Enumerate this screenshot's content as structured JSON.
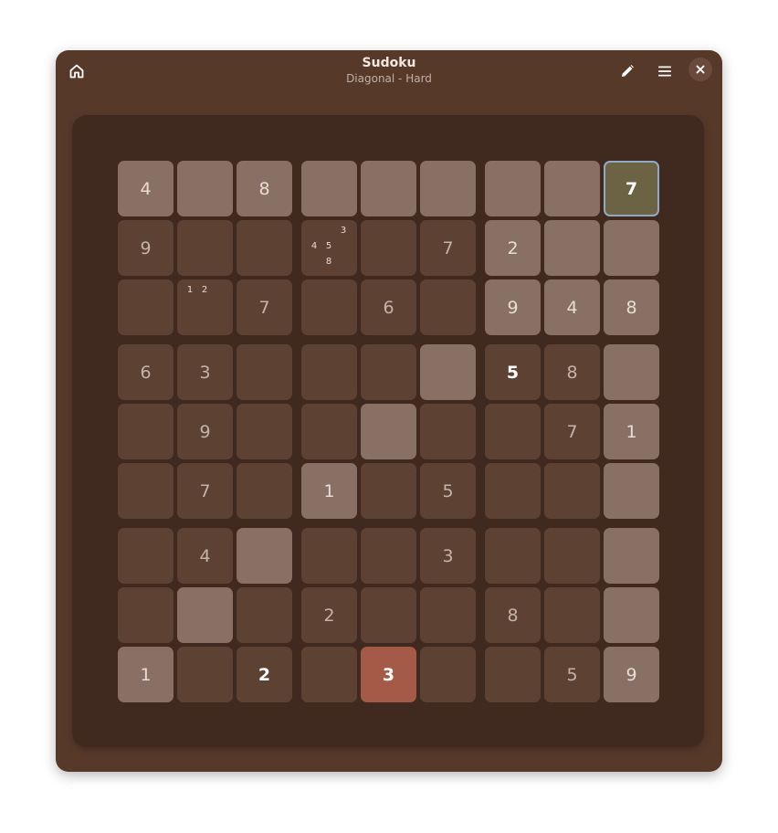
{
  "header": {
    "title": "Sudoku",
    "subtitle": "Diagonal - Hard",
    "buttons": {
      "home": "home-icon",
      "pencil": "pencil-icon",
      "menu": "hamburger-menu-icon",
      "close": "close-icon"
    }
  },
  "colors": {
    "window_bg": "#57392a",
    "board_bg": "#40291f",
    "cell_dark": "#5d4234",
    "cell_light": "#887064",
    "cell_selected": "#6b6343",
    "cell_selected_border": "#8fa9c6",
    "cell_error": "#a55a48"
  },
  "board": {
    "selected_cell": [
      0,
      8
    ],
    "error_cell": [
      8,
      4
    ],
    "cells": [
      [
        {
          "v": "4",
          "shade": "light"
        },
        {
          "v": "",
          "shade": "light"
        },
        {
          "v": "8",
          "shade": "light"
        },
        {
          "v": "",
          "shade": "light"
        },
        {
          "v": "",
          "shade": "light"
        },
        {
          "v": "",
          "shade": "light"
        },
        {
          "v": "",
          "shade": "light"
        },
        {
          "v": "",
          "shade": "light"
        },
        {
          "v": "7",
          "shade": "selected"
        }
      ],
      [
        {
          "v": "9",
          "shade": "dark"
        },
        {
          "v": "",
          "shade": "dark"
        },
        {
          "v": "",
          "shade": "dark"
        },
        {
          "v": "",
          "shade": "dark",
          "notes": [
            "3",
            "4",
            "5",
            "8"
          ]
        },
        {
          "v": "",
          "shade": "dark"
        },
        {
          "v": "7",
          "shade": "dark"
        },
        {
          "v": "2",
          "shade": "light"
        },
        {
          "v": "",
          "shade": "light"
        },
        {
          "v": "",
          "shade": "light"
        }
      ],
      [
        {
          "v": "",
          "shade": "dark"
        },
        {
          "v": "",
          "shade": "dark",
          "notes": [
            "1",
            "2"
          ]
        },
        {
          "v": "7",
          "shade": "dark"
        },
        {
          "v": "",
          "shade": "dark"
        },
        {
          "v": "6",
          "shade": "dark"
        },
        {
          "v": "",
          "shade": "dark"
        },
        {
          "v": "9",
          "shade": "light"
        },
        {
          "v": "4",
          "shade": "light"
        },
        {
          "v": "8",
          "shade": "light"
        }
      ],
      [
        {
          "v": "6",
          "shade": "dark"
        },
        {
          "v": "3",
          "shade": "dark"
        },
        {
          "v": "",
          "shade": "dark"
        },
        {
          "v": "",
          "shade": "dark"
        },
        {
          "v": "",
          "shade": "dark"
        },
        {
          "v": "",
          "shade": "light"
        },
        {
          "v": "5",
          "shade": "dark",
          "bright": true
        },
        {
          "v": "8",
          "shade": "dark"
        },
        {
          "v": "",
          "shade": "light"
        }
      ],
      [
        {
          "v": "",
          "shade": "dark"
        },
        {
          "v": "9",
          "shade": "dark"
        },
        {
          "v": "",
          "shade": "dark"
        },
        {
          "v": "",
          "shade": "dark"
        },
        {
          "v": "",
          "shade": "light"
        },
        {
          "v": "",
          "shade": "dark"
        },
        {
          "v": "",
          "shade": "dark"
        },
        {
          "v": "7",
          "shade": "dark"
        },
        {
          "v": "1",
          "shade": "light"
        }
      ],
      [
        {
          "v": "",
          "shade": "dark"
        },
        {
          "v": "7",
          "shade": "dark"
        },
        {
          "v": "",
          "shade": "dark"
        },
        {
          "v": "1",
          "shade": "light"
        },
        {
          "v": "",
          "shade": "dark"
        },
        {
          "v": "5",
          "shade": "dark"
        },
        {
          "v": "",
          "shade": "dark"
        },
        {
          "v": "",
          "shade": "dark"
        },
        {
          "v": "",
          "shade": "light"
        }
      ],
      [
        {
          "v": "",
          "shade": "dark"
        },
        {
          "v": "4",
          "shade": "dark"
        },
        {
          "v": "",
          "shade": "light"
        },
        {
          "v": "",
          "shade": "dark"
        },
        {
          "v": "",
          "shade": "dark"
        },
        {
          "v": "3",
          "shade": "dark"
        },
        {
          "v": "",
          "shade": "dark"
        },
        {
          "v": "",
          "shade": "dark"
        },
        {
          "v": "",
          "shade": "light"
        }
      ],
      [
        {
          "v": "",
          "shade": "dark"
        },
        {
          "v": "",
          "shade": "light"
        },
        {
          "v": "",
          "shade": "dark"
        },
        {
          "v": "2",
          "shade": "dark"
        },
        {
          "v": "",
          "shade": "dark"
        },
        {
          "v": "",
          "shade": "dark"
        },
        {
          "v": "8",
          "shade": "dark"
        },
        {
          "v": "",
          "shade": "dark"
        },
        {
          "v": "",
          "shade": "light"
        }
      ],
      [
        {
          "v": "1",
          "shade": "light"
        },
        {
          "v": "",
          "shade": "dark"
        },
        {
          "v": "2",
          "shade": "dark",
          "bright": true
        },
        {
          "v": "",
          "shade": "dark"
        },
        {
          "v": "3",
          "shade": "error"
        },
        {
          "v": "",
          "shade": "dark"
        },
        {
          "v": "",
          "shade": "dark"
        },
        {
          "v": "5",
          "shade": "dark"
        },
        {
          "v": "9",
          "shade": "light"
        }
      ]
    ]
  }
}
